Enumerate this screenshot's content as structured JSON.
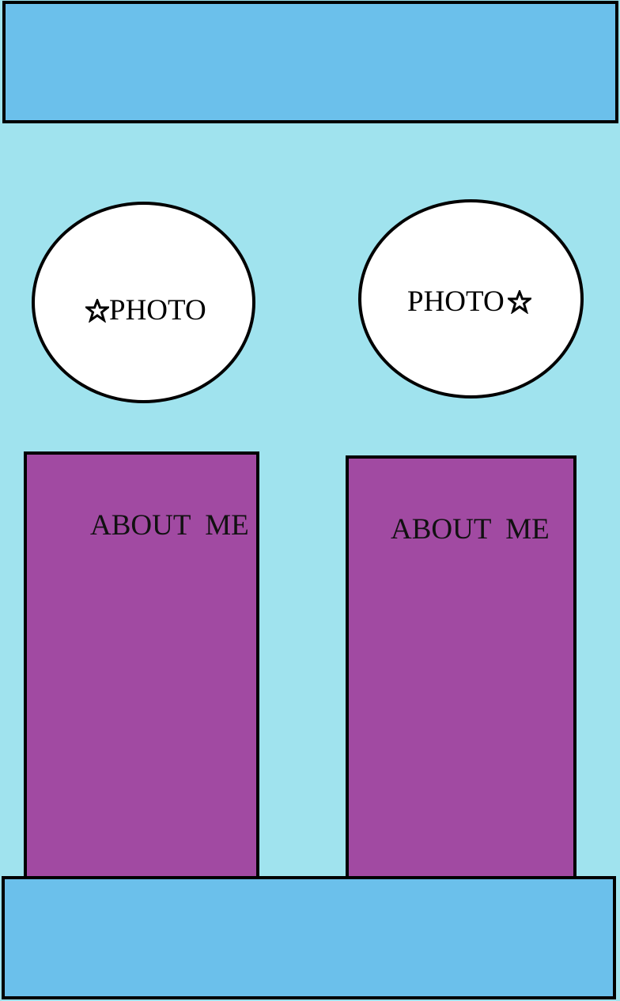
{
  "header": {
    "label": ""
  },
  "profiles": [
    {
      "photo_label": "PHOTO",
      "star_position": "left",
      "about_title": "ABOUT  ME"
    },
    {
      "photo_label": "PHOTO",
      "star_position": "right",
      "about_title": "ABOUT  ME"
    }
  ],
  "footer": {
    "label": ""
  },
  "colors": {
    "background": "#a0e3ee",
    "bars": "#6bc0eb",
    "about_panels": "#a14aa2",
    "photo_fill": "#ffffff",
    "outline": "#000000"
  },
  "icons": [
    "star-icon"
  ]
}
